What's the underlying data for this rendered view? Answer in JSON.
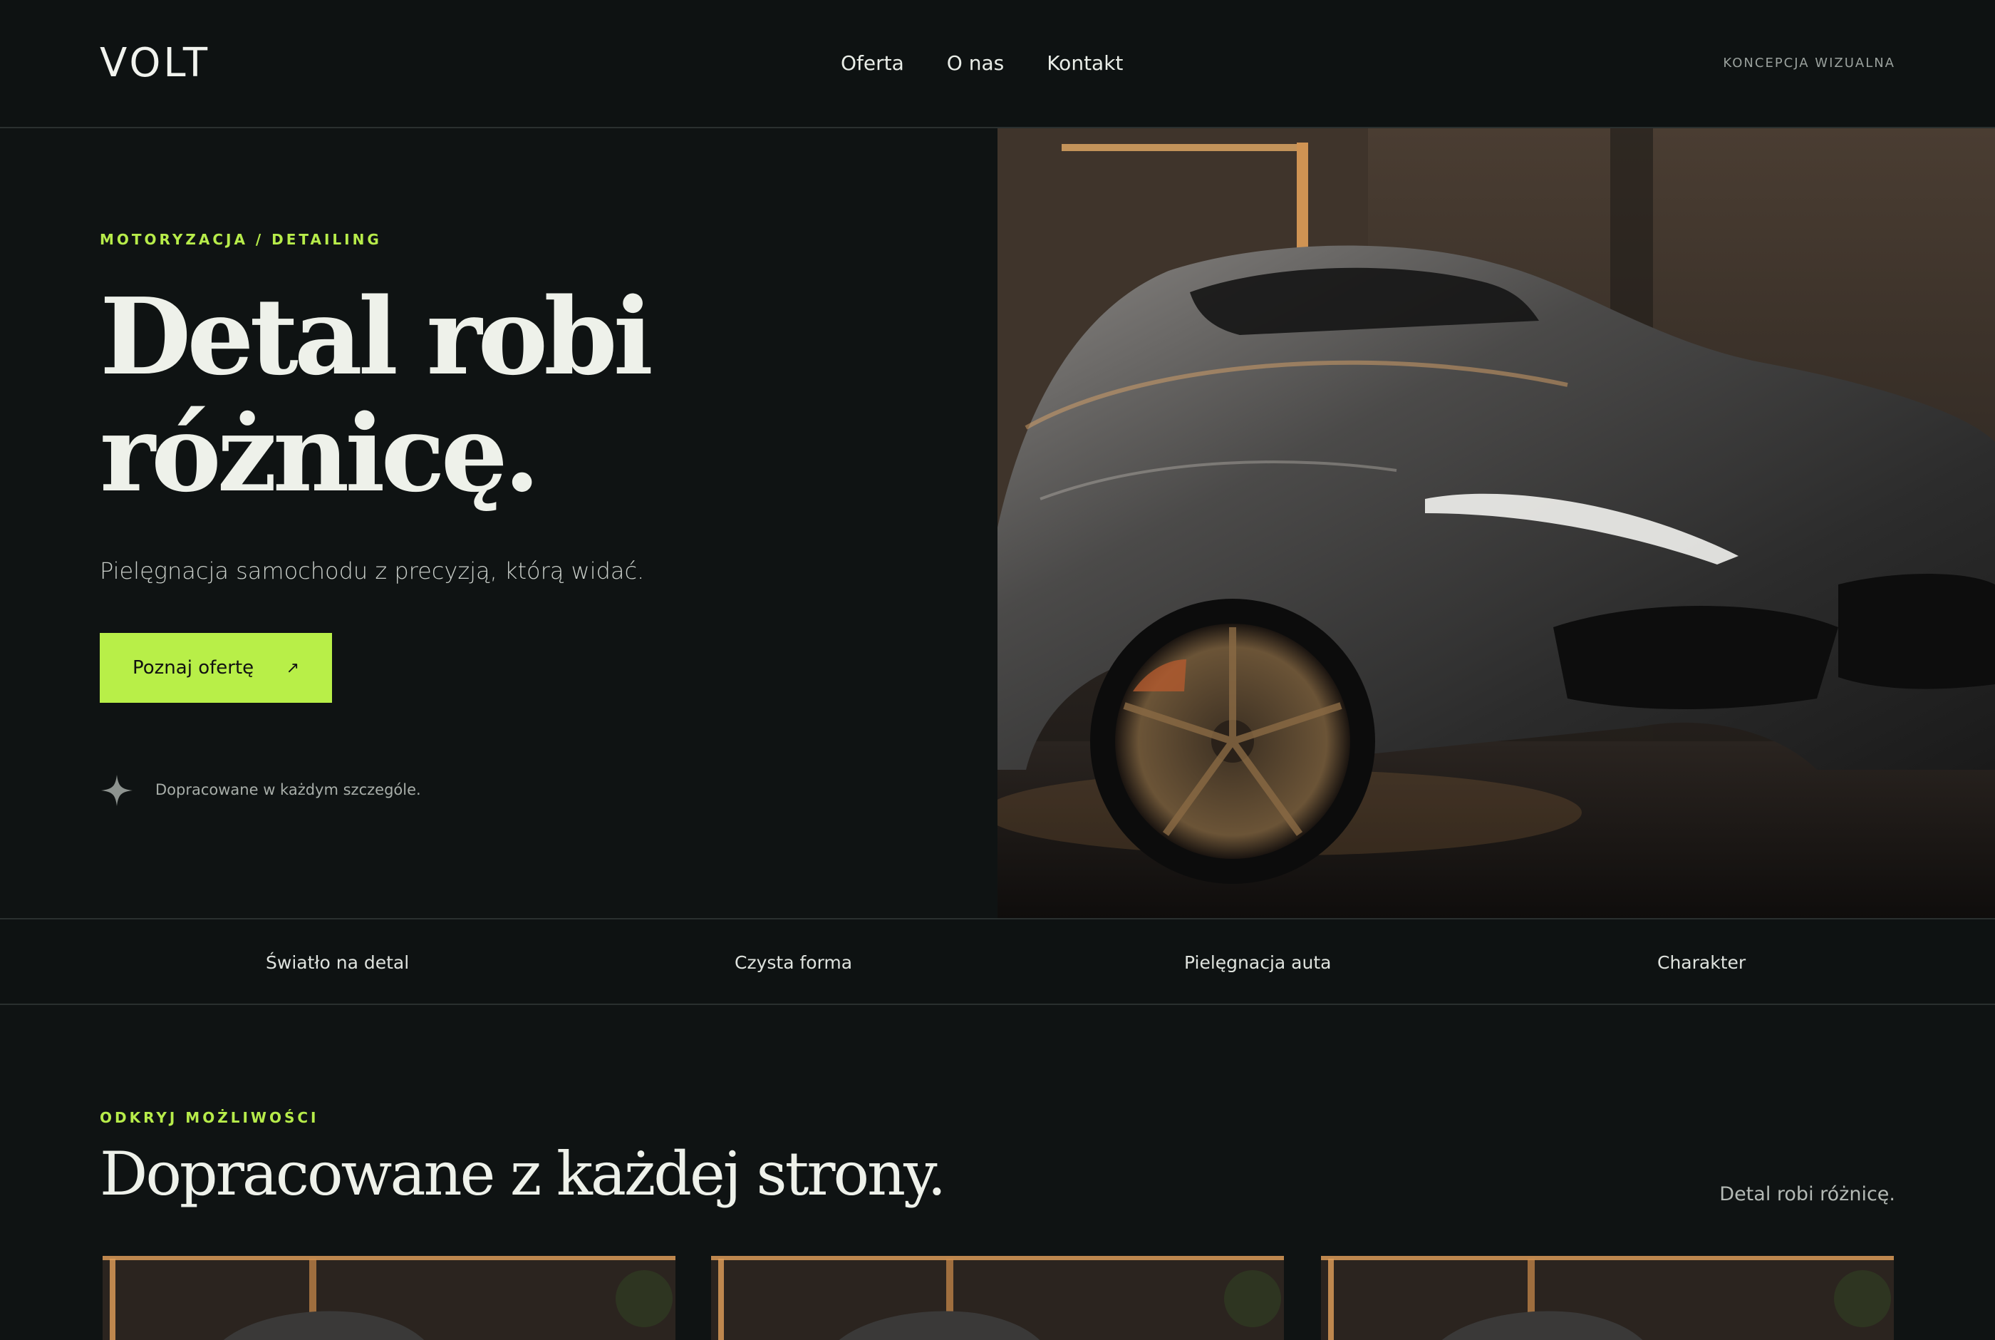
{
  "header": {
    "logo": "VOLT",
    "nav": [
      "Oferta",
      "O nas",
      "Kontakt"
    ],
    "right_label": "KONCEPCJA WIZUALNA"
  },
  "hero": {
    "eyebrow": "MOTORYZACJA / DETAILING",
    "title_line1": "Detal robi",
    "title_line2": "różnicę.",
    "subtitle": "Pielęgnacja samochodu z precyzją, którą widać.",
    "cta_label": "Poznaj ofertę",
    "cta_icon": "arrow-up-right-icon",
    "note": "Dopracowane w każdym szczególe.",
    "note_icon": "sparkle-icon"
  },
  "strip": [
    "Światło na detal",
    "Czysta forma",
    "Pielęgnacja auta",
    "Charakter"
  ],
  "section": {
    "eyebrow": "ODKRYJ MOŻLIWOŚCI",
    "title": "Dopracowane z każdej strony.",
    "tagline": "Detal robi różnicę.",
    "cards": 3
  },
  "colors": {
    "background": "#0f1313",
    "accent": "#b8ef48",
    "text": "#eef1ea",
    "muted": "#a8aea9",
    "border": "#2a302f"
  }
}
